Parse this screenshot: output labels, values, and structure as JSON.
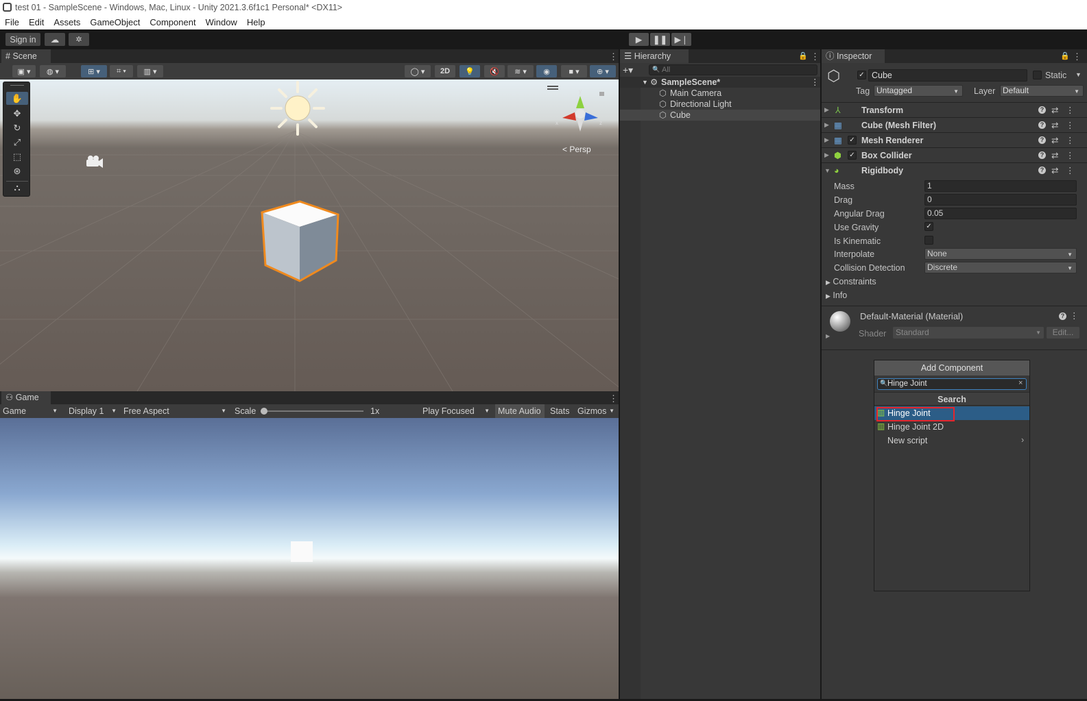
{
  "window": {
    "title": "test 01 - SampleScene - Windows, Mac, Linux - Unity 2021.3.6f1c1 Personal* <DX11>"
  },
  "menu": [
    "File",
    "Edit",
    "Assets",
    "GameObject",
    "Component",
    "Window",
    "Help"
  ],
  "toolbar": {
    "sign_in": "Sign in"
  },
  "scene": {
    "tab": "Scene",
    "btn_2d": "2D",
    "persp": "Persp"
  },
  "game": {
    "tab": "Game",
    "mode": "Game",
    "display": "Display 1",
    "aspect": "Free Aspect",
    "scale_label": "Scale",
    "scale_value": "1x",
    "play_focused": "Play Focused",
    "mute": "Mute Audio",
    "stats": "Stats",
    "gizmos": "Gizmos"
  },
  "hierarchy": {
    "tab": "Hierarchy",
    "search_placeholder": "All",
    "scene_name": "SampleScene*",
    "items": [
      "Main Camera",
      "Directional Light",
      "Cube"
    ]
  },
  "inspector": {
    "tab": "Inspector",
    "object_name": "Cube",
    "static_label": "Static",
    "tag_label": "Tag",
    "tag_value": "Untagged",
    "layer_label": "Layer",
    "layer_value": "Default",
    "components": [
      "Transform",
      "Cube (Mesh Filter)",
      "Mesh Renderer",
      "Box Collider",
      "Rigidbody"
    ],
    "rigidbody": {
      "mass_label": "Mass",
      "mass": "1",
      "drag_label": "Drag",
      "drag": "0",
      "angular_drag_label": "Angular Drag",
      "angular_drag": "0.05",
      "use_gravity_label": "Use Gravity",
      "use_gravity": true,
      "is_kinematic_label": "Is Kinematic",
      "is_kinematic": false,
      "interpolate_label": "Interpolate",
      "interpolate": "None",
      "collision_label": "Collision Detection",
      "collision": "Discrete",
      "constraints_label": "Constraints",
      "info_label": "Info"
    },
    "material": {
      "name": "Default-Material (Material)",
      "shader_label": "Shader",
      "shader": "Standard",
      "edit": "Edit..."
    },
    "add_component": "Add Component"
  },
  "add_component_popup": {
    "search_value": "Hinge Joint",
    "header": "Search",
    "results": [
      "Hinge Joint",
      "Hinge Joint 2D",
      "New script"
    ]
  },
  "colors": {
    "selected_row": "#2c5d87",
    "highlight_box": "#e8242a",
    "cube_outline": "#f08a1e"
  }
}
